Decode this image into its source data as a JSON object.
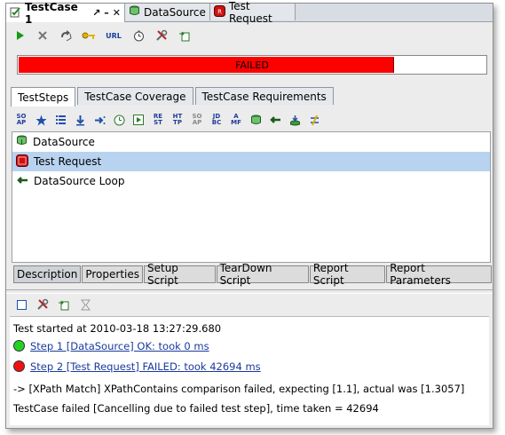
{
  "editor_tabs": [
    {
      "label": "TestCase 1",
      "active": true
    },
    {
      "label": "DataSource",
      "active": false
    },
    {
      "label": "Test Request",
      "active": false
    }
  ],
  "window_controls": {
    "pin": "↗",
    "minimize": "–",
    "close": "✕"
  },
  "toolbar": {
    "url_label": "URL"
  },
  "progress": {
    "label": "FAILED",
    "fraction": 0.8,
    "color": "#ff0000"
  },
  "inner_tabs": [
    "TestSteps",
    "TestCase Coverage",
    "TestCase Requirements"
  ],
  "step_toolbar": {
    "soap": "SO AP",
    "rest": "RE ST",
    "http": "HT TP",
    "soap_mock": "SO AP",
    "jdbc": "JD BC",
    "amf": "A MF"
  },
  "steps": [
    {
      "label": "DataSource",
      "selected": false,
      "icon": "datasource-icon"
    },
    {
      "label": "Test Request",
      "selected": true,
      "icon": "test-request-icon"
    },
    {
      "label": "DataSource Loop",
      "selected": false,
      "icon": "datasource-loop-icon"
    }
  ],
  "bottom_tabs": [
    "Description",
    "Properties",
    "Setup Script",
    "TearDown Script",
    "Report Script",
    "Report Parameters"
  ],
  "log": {
    "started": "Test started at 2010-03-18 13:27:29.680",
    "step1": "Step 1 [DataSource] OK: took 0 ms",
    "step2": "Step 2 [Test Request] FAILED: took 42694 ms",
    "detail": "-> [XPath Match] XPathContains comparison failed, expecting [1.1], actual was [1.3057]",
    "summary": "TestCase failed [Cancelling due to failed test step], time taken = 42694"
  }
}
